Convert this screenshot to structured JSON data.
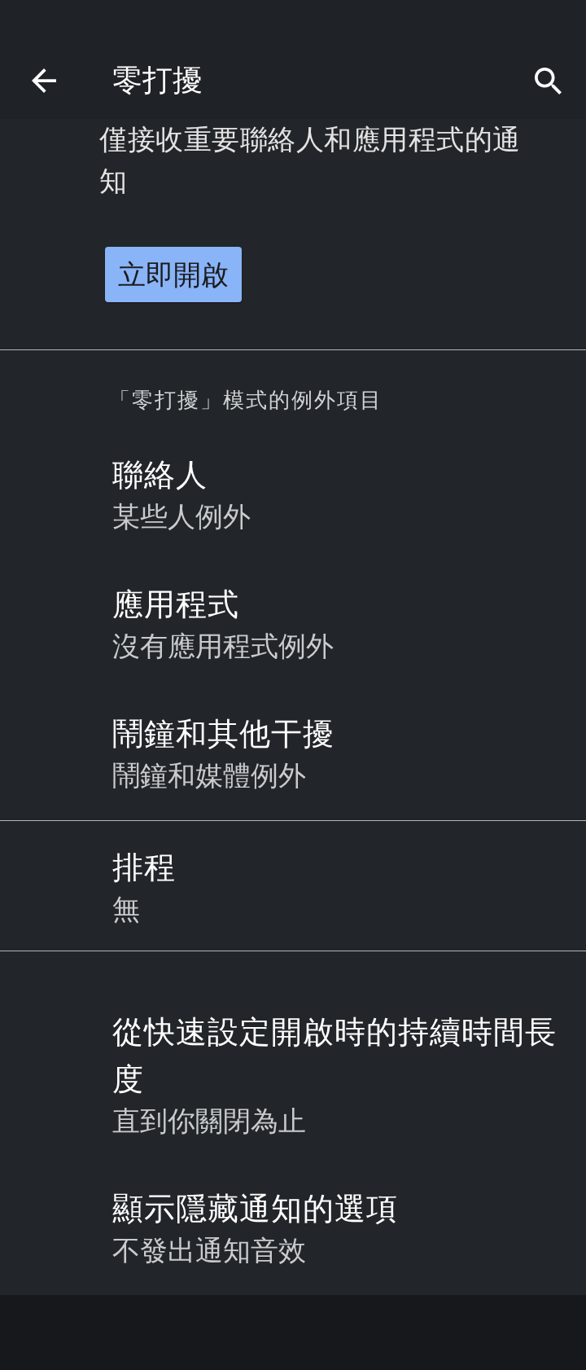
{
  "app_bar": {
    "title": "零打擾"
  },
  "turn_on": {
    "description": "僅接收重要聯絡人和應用程式的通知",
    "button": "立即開啟"
  },
  "sections": [
    {
      "header": "「零打擾」模式的例外項目",
      "items": [
        {
          "title": "聯絡人",
          "summary": "某些人例外"
        },
        {
          "title": "應用程式",
          "summary": "沒有應用程式例外"
        },
        {
          "title": "鬧鐘和其他干擾",
          "summary": "鬧鐘和媒體例外"
        }
      ]
    },
    {
      "items": [
        {
          "title": "排程",
          "summary": "無"
        }
      ]
    },
    {
      "items": [
        {
          "title": "從快速設定開啟時的持續時間長度",
          "summary": "直到你關閉為止"
        },
        {
          "title": "顯示隱藏通知的選項",
          "summary": "不發出通知音效"
        }
      ]
    }
  ]
}
